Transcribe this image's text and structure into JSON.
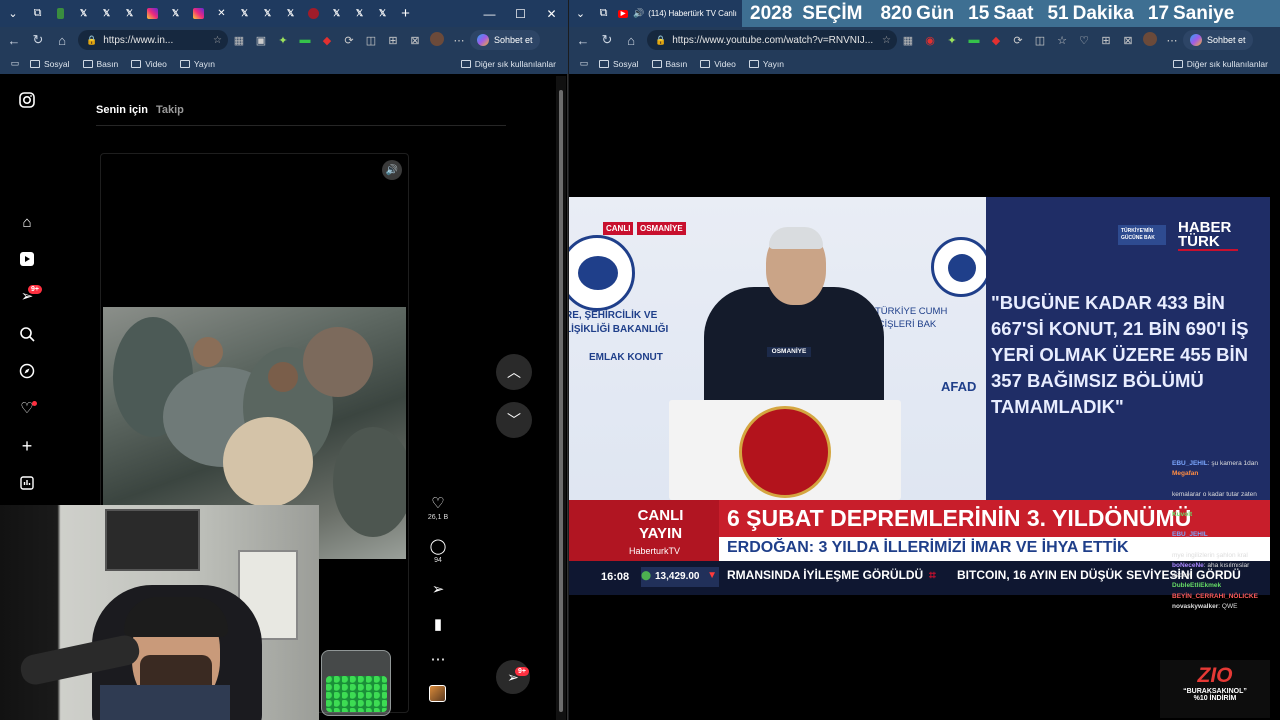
{
  "left_browser": {
    "tabs": [
      {
        "icon": "browser-icon",
        "color": "#ffffff"
      },
      {
        "icon": "x-logo-icon",
        "color": "#ffffff"
      },
      {
        "icon": "x-logo-icon",
        "color": "#ffffff"
      },
      {
        "icon": "x-logo-icon",
        "color": "#ffffff"
      },
      {
        "icon": "instagram-icon",
        "color": "#e1306c"
      },
      {
        "icon": "x-logo-icon",
        "color": "#ffffff"
      },
      {
        "icon": "instagram-icon",
        "color": "#e1306c"
      },
      {
        "icon": "x-logo-icon",
        "color": "#ffffff"
      },
      {
        "icon": "x-logo-icon",
        "color": "#ffffff"
      },
      {
        "icon": "x-logo-icon",
        "color": "#ffffff"
      },
      {
        "icon": "x-logo-icon",
        "color": "#ffffff"
      },
      {
        "icon": "x-logo-icon",
        "color": "#ffffff"
      },
      {
        "icon": "x-logo-icon",
        "color": "#ffffff"
      },
      {
        "icon": "x-logo-icon",
        "color": "#ffffff"
      }
    ],
    "url": "https://www.in...",
    "chat_label": "Sohbet et",
    "bookmarks": [
      "Sosyal",
      "Basın",
      "Video",
      "Yayın"
    ],
    "other_bookmarks": "Diğer sık kullanılanlar"
  },
  "instagram": {
    "nav_icons": [
      "home-icon",
      "reels-icon",
      "direct-icon",
      "search-icon",
      "explore-icon",
      "notifications-icon",
      "create-icon",
      "dashboard-icon"
    ],
    "notification_badge": "9+",
    "feed_tab_active": "Senin için",
    "feed_tab_inactive": "Takip",
    "likes": "26,1 B",
    "comments": "94",
    "messages_badge": "9+"
  },
  "right_browser": {
    "tab_title": "(114) Habertürk TV Canlı",
    "url": "https://www.youtube.com/watch?v=RNVNIJ...",
    "chat_label": "Sohbet et",
    "bookmarks": [
      "Sosyal",
      "Basın",
      "Video",
      "Yayın"
    ],
    "other_bookmarks": "Diğer sık kullanılanlar"
  },
  "countdown": {
    "year": "2028",
    "event": "SEÇİM",
    "days_value": "820",
    "days_label": "Gün",
    "hours_value": "15",
    "hours_label": "Saat",
    "minutes_value": "51",
    "minutes_label": "Dakika",
    "seconds_value": "17",
    "seconds_label": "Saniye"
  },
  "broadcast": {
    "live_tag": "CANLI",
    "location_tag": "OSMANİYE",
    "podium_label": "OSMANİYE",
    "logo_caption": "TÜRKİYE'MİN GÜCÜNE BAK",
    "channel_logo": "HABER TÜRK",
    "backdrop_left": "RE, ŞEHİRCİLİK VE\nLİŞİKLİĞİ BAKANLIĞI",
    "backdrop_right": "TÜRKİYE CUMH\nİÇİŞLERİ BAK",
    "emlak": "EMLAK KONUT",
    "afad": "AFAD",
    "quote": "\"BUGÜNE KADAR 433 BİN 667'Sİ KONUT, 21 BİN 690'I İŞ YERİ OLMAK ÜZERE 455 BİN 357 BAĞIMSIZ BÖLÜMÜ TAMAMLADIK\"",
    "lower_live_1": "CANLI",
    "lower_live_2": "YAYIN",
    "lower_channel": "HaberturkTV",
    "headline": "6 ŞUBAT DEPREMLERİNİN 3. YILDÖNÜMÜ",
    "subheadline": "ERDOĞAN: 3 YILDA İLLERİMİZİ İMAR VE İHYA ETTİK",
    "clock": "16:08",
    "index_value": "13,429.00",
    "ticker_1": "RMANSINDA İYİLEŞME GÖRÜLDÜ",
    "ticker_2": "BITCOIN, 16 AYIN EN DÜŞÜK SEVİYESİNİ GÖRDÜ"
  },
  "chat": [
    {
      "user": "EBU_JEHIL",
      "text": "şu kamera 1dan",
      "color": "#7ba7ff"
    },
    {
      "user": "Megafan",
      "text": "",
      "color": "#ff8c42"
    },
    {
      "user": "",
      "text": "",
      "color": "#ffffff"
    },
    {
      "user": "",
      "text": "kemalarar o kadar tutar zaten",
      "color": "#cccccc"
    },
    {
      "user": "",
      "text": "",
      "color": "#cccccc"
    },
    {
      "user": "Kuvolt",
      "text": "",
      "color": "#66dd66"
    },
    {
      "user": "",
      "text": "",
      "color": "#cccccc"
    },
    {
      "user": "EBU_JEHIL",
      "text": "",
      "color": "#7ba7ff"
    },
    {
      "user": "",
      "text": "",
      "color": "#cccccc"
    },
    {
      "user": "",
      "text": "mye ingilizlerin şahlon kral",
      "color": "#cccccc"
    },
    {
      "user": "boNeceNe",
      "text": "aha kısılmıslar",
      "color": "#aa88ff"
    },
    {
      "user": "",
      "text": "dedeyi",
      "color": "#cccccc"
    },
    {
      "user": "DubleEtliEkmek",
      "text": "",
      "color": "#66dd66"
    },
    {
      "user": "BEYİN_CERRAHI_NÖLICKE",
      "text": "",
      "color": "#ff5b5b"
    },
    {
      "user": "novaskywalker",
      "text": "QWE",
      "color": "#dddddd"
    },
    {
      "user": "",
      "text": "",
      "color": "#cccccc"
    }
  ],
  "promo": {
    "brand": "ZIO",
    "line1": "“BURAKSAKINOL”",
    "line2": "%10 İNDİRİM"
  }
}
